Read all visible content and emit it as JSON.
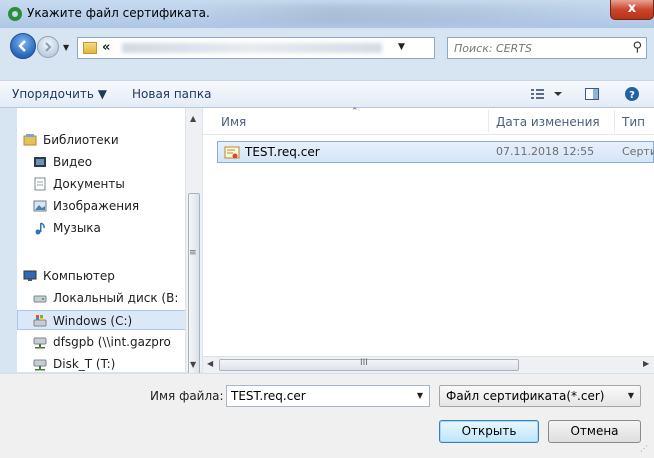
{
  "window": {
    "title": "Укажите файл сертификата.",
    "close_label": "x"
  },
  "navigation": {
    "address_chevron": "«",
    "search_placeholder": "Поиск: CERTS"
  },
  "toolbar": {
    "organize_label": "Упорядочить ▼",
    "new_folder_label": "Новая папка"
  },
  "sidebar": {
    "items": [
      {
        "label": "Библиотеки",
        "icon": "libraries-icon"
      },
      {
        "label": "Видео",
        "icon": "video-icon"
      },
      {
        "label": "Документы",
        "icon": "documents-icon"
      },
      {
        "label": "Изображения",
        "icon": "pictures-icon"
      },
      {
        "label": "Музыка",
        "icon": "music-icon"
      },
      {
        "label": "Компьютер",
        "icon": "computer-icon"
      },
      {
        "label": "Локальный диск (B:",
        "icon": "hard-disk-icon"
      },
      {
        "label": "Windows (C:)",
        "icon": "windows-drive-icon",
        "selected": true
      },
      {
        "label": "dfsgpb (\\\\int.gazpro",
        "icon": "network-drive-icon"
      },
      {
        "label": "Disk_T (T:)",
        "icon": "network-drive-icon"
      }
    ]
  },
  "file_list": {
    "columns": [
      "Имя",
      "Дата изменения",
      "Тип"
    ],
    "rows": [
      {
        "name": "TEST.req.cer",
        "date": "07.11.2018 12:55",
        "type": "Серти"
      }
    ]
  },
  "footer": {
    "file_name_label": "Имя файла:",
    "file_name_value": "TEST.req.cer",
    "file_type_value": "Файл сертификата(*.cer)",
    "open_label": "Открыть",
    "cancel_label": "Отмена"
  },
  "colors": {
    "selection": "#dbe8f8",
    "title_bar": "#b9cfe9",
    "close_button": "#c9462c"
  }
}
